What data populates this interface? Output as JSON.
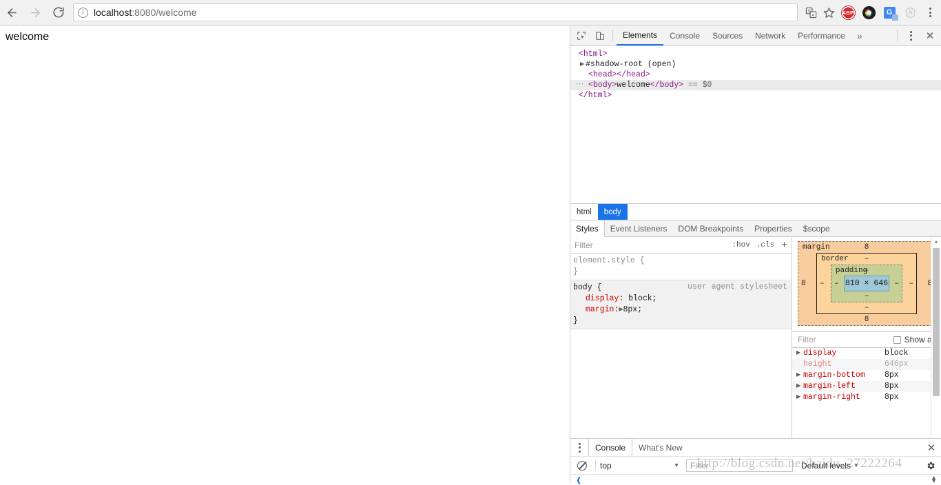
{
  "browser": {
    "back_icon": "arrow-left-icon",
    "forward_icon": "arrow-right-icon",
    "reload_icon": "reload-icon",
    "info_icon": "info-circle-icon",
    "url_host": "localhost",
    "url_rest": ":8080/welcome",
    "url_full": "localhost:8080/welcome",
    "translate_icon": "translate-icon",
    "bookmark_icon": "star-icon",
    "extensions": [
      {
        "name": "adblock-plus-extension-icon",
        "label": "ABP"
      },
      {
        "name": "chrome-extension-icon",
        "label": ""
      },
      {
        "name": "google-translate-extension-icon",
        "label": "G"
      },
      {
        "name": "angular-devtools-extension-icon",
        "label": ""
      }
    ],
    "menu_icon": "kebab-menu-icon"
  },
  "page": {
    "body_text": "welcome"
  },
  "devtools": {
    "inspect_icon": "inspect-element-icon",
    "device_icon": "device-toolbar-icon",
    "tabs": [
      {
        "label": "Elements",
        "active": true
      },
      {
        "label": "Console",
        "active": false
      },
      {
        "label": "Sources",
        "active": false
      },
      {
        "label": "Network",
        "active": false
      },
      {
        "label": "Performance",
        "active": false
      }
    ],
    "more_tabs_icon": "chevron-double-right-icon",
    "settings_icon": "kebab-menu-icon",
    "close_icon": "close-icon",
    "dom": {
      "line1_open": "<html>",
      "shadow_root": "#shadow-root (open)",
      "line_head": "<head></head>",
      "body_open": "<body>",
      "body_text": "welcome",
      "body_close": "</body>",
      "body_ref": "== $0",
      "line_close": "</html>"
    },
    "breadcrumb": [
      {
        "label": "html",
        "selected": false
      },
      {
        "label": "body",
        "selected": true
      }
    ],
    "sub_tabs": [
      {
        "label": "Styles",
        "active": true
      },
      {
        "label": "Event Listeners",
        "active": false
      },
      {
        "label": "DOM Breakpoints",
        "active": false
      },
      {
        "label": "Properties",
        "active": false
      },
      {
        "label": "$scope",
        "active": false
      }
    ],
    "styles": {
      "filter_placeholder": "Filter",
      "hov_label": ":hov",
      "cls_label": ".cls",
      "new_rule_label": "+",
      "rules": [
        {
          "selector": "element.style {",
          "close": "}",
          "origin": "",
          "declarations": []
        },
        {
          "selector": "body {",
          "close": "}",
          "origin": "user agent stylesheet",
          "declarations": [
            {
              "prop": "display",
              "value": "block;",
              "expandable": false
            },
            {
              "prop": "margin",
              "value": "8px;",
              "expandable": true
            }
          ]
        }
      ]
    },
    "box_model": {
      "margin_label": "margin",
      "margin_top": "8",
      "margin_right": "8",
      "margin_bottom": "8",
      "margin_left": "8",
      "border_label": "border",
      "border_top": "–",
      "border_right": "–",
      "border_bottom": "–",
      "border_left": "–",
      "padding_label": "padding",
      "padding_top": "–",
      "padding_right": "–",
      "padding_bottom": "–",
      "padding_left": "–",
      "content_size": "810 × 646",
      "colors": {
        "margin": "#f9cc9d",
        "border": "#fdd49c",
        "padding": "#c6cf94",
        "content": "#9fc8d8"
      }
    },
    "computed": {
      "filter_placeholder": "Filter",
      "show_all_label": "Show all",
      "show_all_checked": false,
      "properties": [
        {
          "name": "display",
          "value": "block",
          "inherited": false,
          "expandable": true
        },
        {
          "name": "height",
          "value": "646px",
          "inherited": true,
          "expandable": false
        },
        {
          "name": "margin-bottom",
          "value": "8px",
          "inherited": false,
          "expandable": true
        },
        {
          "name": "margin-left",
          "value": "8px",
          "inherited": false,
          "expandable": true
        },
        {
          "name": "margin-right",
          "value": "8px",
          "inherited": false,
          "expandable": true
        }
      ]
    }
  },
  "drawer": {
    "menu_icon": "kebab-menu-icon",
    "tabs": [
      {
        "label": "Console",
        "active": true
      },
      {
        "label": "What's New",
        "active": false
      }
    ],
    "close_icon": "close-icon",
    "clear_icon": "clear-console-icon",
    "context": "top",
    "filter_placeholder": "Filter",
    "levels_label": "Default levels",
    "settings_icon": "gear-icon",
    "prompt_icon": "console-prompt-icon"
  },
  "watermark": {
    "text": "http://blog.csdn.net/baidu_27222264"
  },
  "accent": "#1a73e8"
}
